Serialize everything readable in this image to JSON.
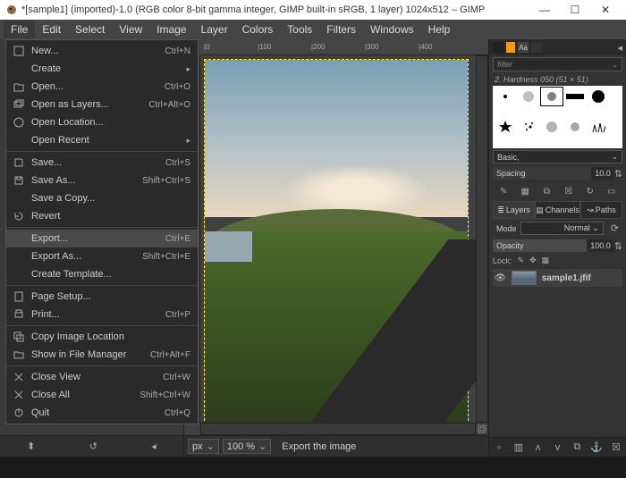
{
  "title": "*[sample1] (imported)-1.0 (RGB color 8-bit gamma integer, GIMP built-in sRGB, 1 layer) 1024x512 – GIMP",
  "menus": [
    "File",
    "Edit",
    "Select",
    "View",
    "Image",
    "Layer",
    "Colors",
    "Tools",
    "Filters",
    "Windows",
    "Help"
  ],
  "active_menu": 0,
  "file_menu": [
    {
      "icon": "new",
      "label": "New...",
      "accel": "Ctrl+N"
    },
    {
      "icon": "",
      "label": "Create",
      "arrow": true
    },
    {
      "icon": "open",
      "label": "Open...",
      "accel": "Ctrl+O"
    },
    {
      "icon": "layers",
      "label": "Open as Layers...",
      "accel": "Ctrl+Alt+O"
    },
    {
      "icon": "loc",
      "label": "Open Location..."
    },
    {
      "icon": "",
      "label": "Open Recent",
      "arrow": true
    },
    {
      "sep": true
    },
    {
      "icon": "save",
      "label": "Save...",
      "accel": "Ctrl+S"
    },
    {
      "icon": "saveas",
      "label": "Save As...",
      "accel": "Shift+Ctrl+S"
    },
    {
      "icon": "",
      "label": "Save a Copy..."
    },
    {
      "icon": "revert",
      "label": "Revert"
    },
    {
      "sep": true
    },
    {
      "icon": "",
      "label": "Export...",
      "accel": "Ctrl+E",
      "hover": true
    },
    {
      "icon": "",
      "label": "Export As...",
      "accel": "Shift+Ctrl+E"
    },
    {
      "icon": "",
      "label": "Create Template..."
    },
    {
      "sep": true
    },
    {
      "icon": "page",
      "label": "Page Setup..."
    },
    {
      "icon": "print",
      "label": "Print...",
      "accel": "Ctrl+P"
    },
    {
      "sep": true
    },
    {
      "icon": "copy",
      "label": "Copy Image Location"
    },
    {
      "icon": "fm",
      "label": "Show in File Manager",
      "accel": "Ctrl+Alt+F"
    },
    {
      "sep": true
    },
    {
      "icon": "close",
      "label": "Close View",
      "accel": "Ctrl+W"
    },
    {
      "icon": "close",
      "label": "Close All",
      "accel": "Shift+Ctrl+W"
    },
    {
      "icon": "quit",
      "label": "Quit",
      "accel": "Ctrl+Q"
    }
  ],
  "ruler_marks": [
    "0",
    "100",
    "200",
    "300",
    "400"
  ],
  "footer": {
    "unit": "px",
    "zoom": "100 %",
    "status": "Export the image"
  },
  "right": {
    "search_ph": "filter",
    "brush_label": "2. Hardness 050 (51 × 51)",
    "preset": "Basic,",
    "spacing_label": "Spacing",
    "spacing_val": "10.0",
    "tabs": [
      "Layers",
      "Channels",
      "Paths"
    ],
    "mode_label": "Mode",
    "mode_val": "Normal",
    "opacity_label": "Opacity",
    "opacity_val": "100.0",
    "lock_label": "Lock:",
    "layer_name": "sample1.jfif"
  }
}
